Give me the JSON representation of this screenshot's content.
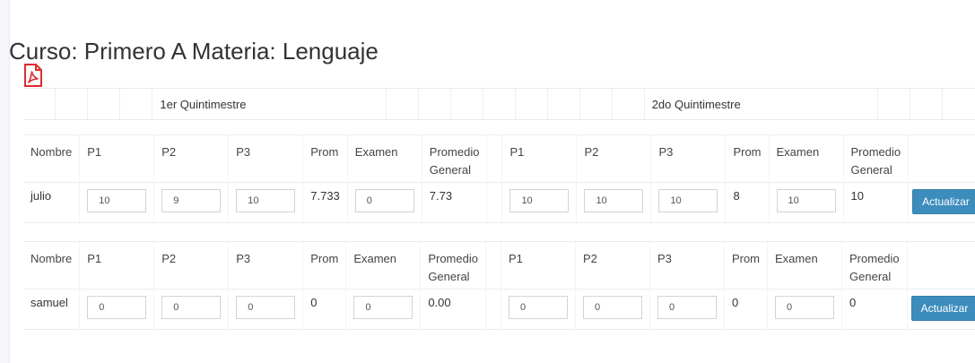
{
  "course": {
    "title": "Curso: Primero A Materia: Lenguaje"
  },
  "quintimestres": {
    "first": "1er Quintimestre",
    "second": "2do Quintimestre"
  },
  "columns": {
    "nombre": "Nombre",
    "p1": "P1",
    "p2": "P2",
    "p3": "P3",
    "prom": "Prom",
    "examen": "Examen",
    "promedio_general": "Promedio General"
  },
  "students": [
    {
      "nombre": "julio",
      "q1": {
        "p1": "10",
        "p2": "9",
        "p3": "10",
        "prom": "7.733",
        "examen": "0",
        "promedio_general": "7.73"
      },
      "q2": {
        "p1": "10",
        "p2": "10",
        "p3": "10",
        "prom": "8",
        "examen": "10",
        "promedio_general": "10"
      },
      "action": "Actualizar"
    },
    {
      "nombre": "samuel",
      "q1": {
        "p1": "0",
        "p2": "0",
        "p3": "0",
        "prom": "0",
        "examen": "0",
        "promedio_general": "0.00"
      },
      "q2": {
        "p1": "0",
        "p2": "0",
        "p3": "0",
        "prom": "0",
        "examen": "0",
        "promedio_general": "0"
      },
      "action": "Actualizar"
    }
  ],
  "icons": {
    "pdf": "pdf-icon",
    "pdf_color": "#dd2c2c"
  },
  "colors": {
    "button": "#3c8dbc"
  }
}
